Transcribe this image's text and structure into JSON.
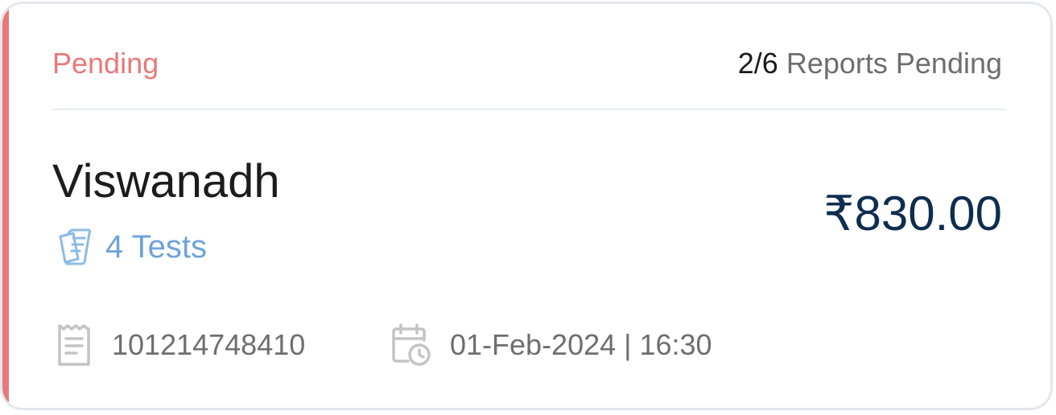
{
  "card": {
    "status": "Pending",
    "reports": {
      "count": "2/6",
      "label": "Reports Pending"
    },
    "patient_name": "Viswanadh",
    "tests": {
      "label": "4 Tests",
      "icon": "test-sheets-icon"
    },
    "amount": "₹830.00",
    "receipt_number": "101214748410",
    "datetime": "01-Feb-2024 | 16:30"
  },
  "colors": {
    "status_accent": "#e9787a",
    "tests_link": "#6ea3d9",
    "amount": "#0f2d4f",
    "muted_text": "#6e6e6e",
    "border": "#e3e7ef"
  }
}
